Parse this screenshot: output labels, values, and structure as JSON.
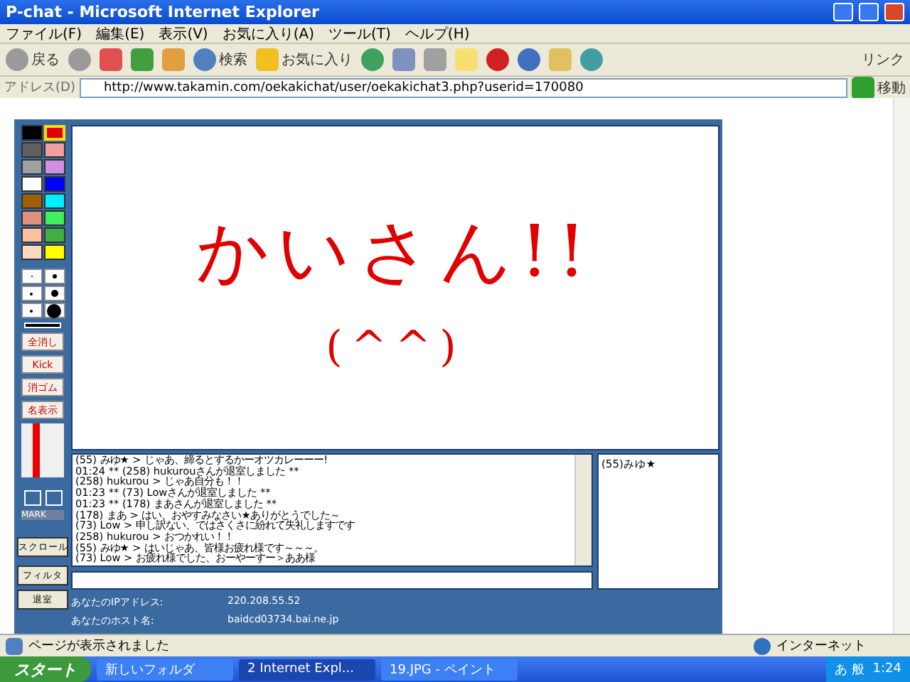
{
  "window": {
    "title": "P-chat - Microsoft Internet Explorer"
  },
  "menu": [
    "ファイル(F)",
    "編集(E)",
    "表示(V)",
    "お気に入り(A)",
    "ツール(T)",
    "ヘルプ(H)"
  ],
  "toolbar": {
    "back": "戻る",
    "search": "検索",
    "favorites": "お気に入り",
    "links": "リンク"
  },
  "address": {
    "label": "アドレス(D)",
    "url": "http://www.takamin.com/oekakichat/user/oekakichat3.php?userid=170080",
    "go": "移動"
  },
  "palette": [
    {
      "color": "#000000",
      "selected": false
    },
    {
      "color": "#e00000",
      "selected": true
    },
    {
      "color": "#606060",
      "selected": false
    },
    {
      "color": "#f0a0a0",
      "selected": false
    },
    {
      "color": "#a0a0a0",
      "selected": false
    },
    {
      "color": "#d090e0",
      "selected": false
    },
    {
      "color": "#ffffff",
      "selected": false
    },
    {
      "color": "#0000ff",
      "selected": false
    },
    {
      "color": "#a06000",
      "selected": false
    },
    {
      "color": "#00f0ff",
      "selected": false
    },
    {
      "color": "#e09080",
      "selected": false
    },
    {
      "color": "#40f060",
      "selected": false
    },
    {
      "color": "#ffc0a0",
      "selected": false
    },
    {
      "color": "#40b040",
      "selected": false
    },
    {
      "color": "#ffd8c0",
      "selected": false
    },
    {
      "color": "#ffff00",
      "selected": false
    }
  ],
  "tool_buttons": [
    "全消し",
    "Kick",
    "消ゴム",
    "名表示"
  ],
  "color_slider": {
    "level": 1
  },
  "mark_label": "MARK",
  "scroll_button": "スクロール",
  "filter_button": "フィルタ",
  "leave_button": "退室",
  "canvas": {
    "lines": [
      "かいさん!!",
      "(^^)"
    ]
  },
  "chat_log": [
    "(55) みゆ★ > じゃあ、締るとするかーオツカレーーー!",
    "01:24 ** (258) hukurouさんが退室しました **",
    "(258) hukurou > じゃあ自分も！！",
    "01:23 ** (73) Lowさんが退室しました **",
    "01:23 ** (178) まあさんが退室しました **",
    "(178) まあ > はい、おやすみなさい★ありがとうでした～",
    "(73) Low > 申し訳ない、ではさくさに紛れて失礼しますです",
    "(258) hukurou > おつかれい！！",
    "(55) みゆ★ > はいじゃあ、皆様お疲れ様です～～～。",
    "(73) Low > お疲れ様でした、おーやーすー＞ああ様"
  ],
  "members": [
    "(55)みゆ★"
  ],
  "info": [
    {
      "label": "あなたのIPアドレス:",
      "value": "220.208.55.52"
    },
    {
      "label": "あなたのホスト名:",
      "value": "baidcd03734.bai.ne.jp"
    }
  ],
  "status_bar": {
    "text": "ページが表示されました",
    "zone": "インターネット"
  },
  "taskbar": {
    "start": "スタート",
    "tasks": [
      "新しいフォルダ",
      "2 Internet Expl...",
      "19.JPG - ペイント"
    ],
    "ime": "あ 般",
    "clock": "1:24"
  }
}
